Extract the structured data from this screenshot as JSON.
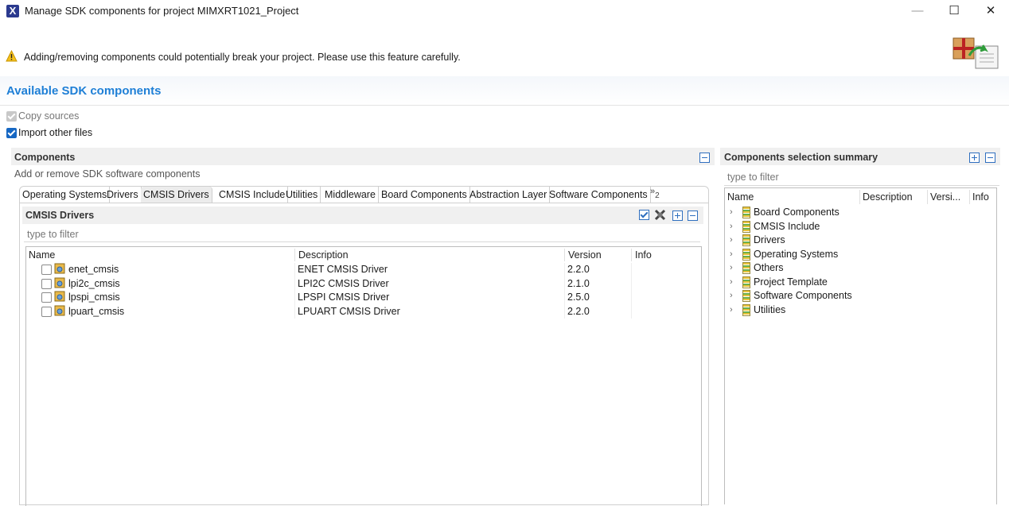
{
  "window": {
    "title": "Manage SDK components for project MIMXRT1021_Project",
    "minimize": "—",
    "maximize": "☐",
    "close": "✕"
  },
  "banner": {
    "warning": "Adding/removing components could potentially break your project. Please use this feature carefully."
  },
  "section": {
    "title": "Available SDK components"
  },
  "options": {
    "copy_sources": {
      "label": "Copy sources",
      "checked": true,
      "disabled": true
    },
    "import_other": {
      "label": "Import other files",
      "checked": true,
      "disabled": false
    }
  },
  "components": {
    "title": "Components",
    "subtitle": "Add or remove SDK software components",
    "tabs": [
      {
        "label": "Operating Systems",
        "active": false
      },
      {
        "label": "Drivers",
        "active": false
      },
      {
        "label": "CMSIS Drivers",
        "active": true
      },
      {
        "label": "CMSIS Include",
        "active": false
      },
      {
        "label": "Utilities",
        "active": false
      },
      {
        "label": "Middleware",
        "active": false
      },
      {
        "label": "Board Components",
        "active": false
      },
      {
        "label": "Abstraction Layer",
        "active": false
      },
      {
        "label": "Software Components",
        "active": false
      }
    ],
    "more_tabs": "»",
    "more_count": "2",
    "inner_title": "CMSIS Drivers",
    "filter_placeholder": "type to filter",
    "columns": {
      "name": "Name",
      "description": "Description",
      "version": "Version",
      "info": "Info"
    },
    "rows": [
      {
        "name": "enet_cmsis",
        "description": "ENET CMSIS Driver",
        "version": "2.2.0",
        "checked": false
      },
      {
        "name": "lpi2c_cmsis",
        "description": "LPI2C CMSIS Driver",
        "version": "2.1.0",
        "checked": false
      },
      {
        "name": "lpspi_cmsis",
        "description": "LPSPI CMSIS Driver",
        "version": "2.5.0",
        "checked": false
      },
      {
        "name": "lpuart_cmsis",
        "description": "LPUART CMSIS Driver",
        "version": "2.2.0",
        "checked": false
      }
    ]
  },
  "summary": {
    "title": "Components selection summary",
    "filter_placeholder": "type to filter",
    "columns": {
      "name": "Name",
      "description": "Description",
      "version": "Versi...",
      "info": "Info"
    },
    "items": [
      {
        "label": "Board Components"
      },
      {
        "label": "CMSIS Include"
      },
      {
        "label": "Drivers"
      },
      {
        "label": "Operating Systems"
      },
      {
        "label": "Others"
      },
      {
        "label": "Project Template"
      },
      {
        "label": "Software Components"
      },
      {
        "label": "Utilities"
      }
    ]
  },
  "colors": {
    "accent": "#1e7fd6",
    "checkbox": "#1667c3",
    "panel": "#f0f0f0"
  }
}
